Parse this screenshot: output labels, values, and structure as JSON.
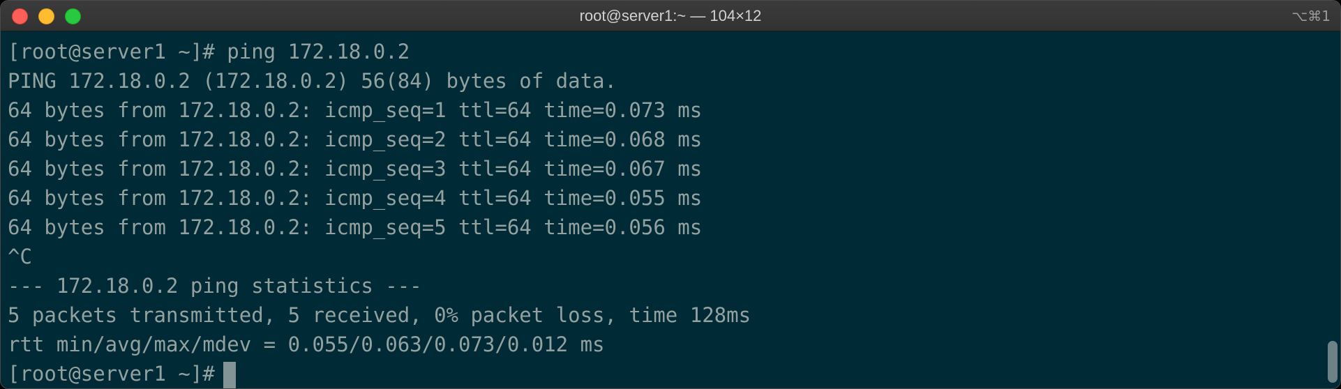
{
  "window": {
    "title": "root@server1:~ — 104×12",
    "shortcut": "⌥⌘1"
  },
  "terminal": {
    "lines": [
      "[root@server1 ~]# ping 172.18.0.2",
      "PING 172.18.0.2 (172.18.0.2) 56(84) bytes of data.",
      "64 bytes from 172.18.0.2: icmp_seq=1 ttl=64 time=0.073 ms",
      "64 bytes from 172.18.0.2: icmp_seq=2 ttl=64 time=0.068 ms",
      "64 bytes from 172.18.0.2: icmp_seq=3 ttl=64 time=0.067 ms",
      "64 bytes from 172.18.0.2: icmp_seq=4 ttl=64 time=0.055 ms",
      "64 bytes from 172.18.0.2: icmp_seq=5 ttl=64 time=0.056 ms",
      "^C",
      "--- 172.18.0.2 ping statistics ---",
      "5 packets transmitted, 5 received, 0% packet loss, time 128ms",
      "rtt min/avg/max/mdev = 0.055/0.063/0.073/0.012 ms"
    ],
    "prompt": "[root@server1 ~]#"
  },
  "colors": {
    "background": "#002b36",
    "foreground": "#93a1a1",
    "cursor": "#839496"
  }
}
